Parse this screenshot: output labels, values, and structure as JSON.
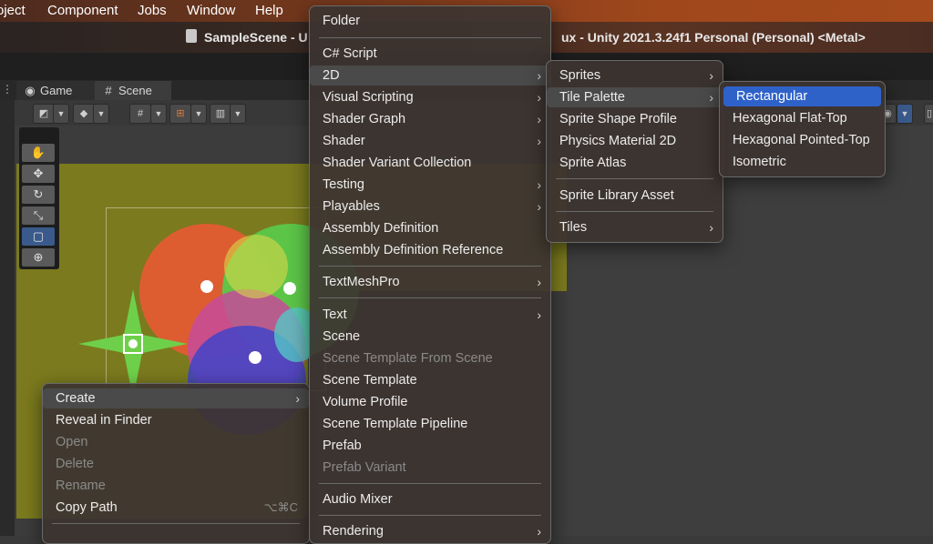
{
  "menubar": {
    "items": [
      "oject",
      "Component",
      "Jobs",
      "Window",
      "Help"
    ]
  },
  "titlebar": {
    "text_left": "SampleScene - U",
    "text_right": "ux - Unity 2021.3.24f1 Personal (Personal) <Metal>"
  },
  "tabs": [
    {
      "label": "Game",
      "icon": "gamepad-icon"
    },
    {
      "label": "Scene",
      "icon": "grid-icon"
    }
  ],
  "context_menu": {
    "items": [
      {
        "label": "Create",
        "submenu": true,
        "enabled": true
      },
      {
        "label": "Reveal in Finder",
        "enabled": true
      },
      {
        "label": "Open",
        "enabled": false
      },
      {
        "label": "Delete",
        "enabled": false
      },
      {
        "label": "Rename",
        "enabled": false
      },
      {
        "label": "Copy Path",
        "enabled": true,
        "shortcut": "⌥⌘C"
      }
    ]
  },
  "create_menu": {
    "items": [
      {
        "label": "Folder"
      },
      {
        "label": "C# Script"
      },
      {
        "label": "2D",
        "submenu": true
      },
      {
        "label": "Visual Scripting",
        "submenu": true
      },
      {
        "label": "Shader Graph",
        "submenu": true
      },
      {
        "label": "Shader",
        "submenu": true
      },
      {
        "label": "Shader Variant Collection"
      },
      {
        "label": "Testing",
        "submenu": true
      },
      {
        "label": "Playables",
        "submenu": true
      },
      {
        "label": "Assembly Definition"
      },
      {
        "label": "Assembly Definition Reference"
      },
      {
        "label": "TextMeshPro",
        "submenu": true
      },
      {
        "label": "Text",
        "submenu": true
      },
      {
        "label": "Scene"
      },
      {
        "label": "Scene Template From Scene",
        "enabled": false
      },
      {
        "label": "Scene Template"
      },
      {
        "label": "Volume Profile"
      },
      {
        "label": "Scene Template Pipeline"
      },
      {
        "label": "Prefab"
      },
      {
        "label": "Prefab Variant",
        "enabled": false
      },
      {
        "label": "Audio Mixer"
      },
      {
        "label": "Rendering",
        "submenu": true
      }
    ]
  },
  "menu_2d": {
    "items": [
      {
        "label": "Sprites",
        "submenu": true
      },
      {
        "label": "Tile Palette",
        "submenu": true
      },
      {
        "label": "Sprite Shape Profile"
      },
      {
        "label": "Physics Material 2D"
      },
      {
        "label": "Sprite Atlas"
      },
      {
        "label": "Sprite Library Asset"
      },
      {
        "label": "Tiles",
        "submenu": true
      }
    ]
  },
  "tile_palette_menu": {
    "items": [
      {
        "label": "Rectangular"
      },
      {
        "label": "Hexagonal Flat-Top"
      },
      {
        "label": "Hexagonal Pointed-Top"
      },
      {
        "label": "Isometric"
      }
    ]
  },
  "colors": {
    "selection": "#2f62c9",
    "menu_bg": "#3c3430"
  }
}
